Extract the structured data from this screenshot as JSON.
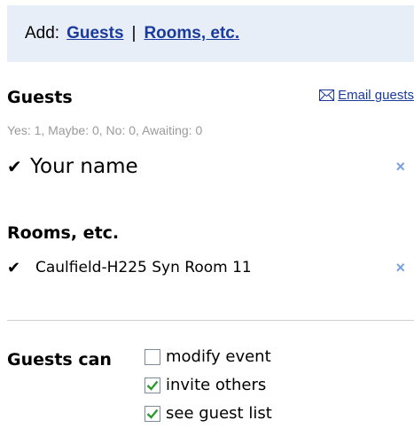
{
  "add_bar": {
    "label": "Add:",
    "guests_link": "Guests",
    "separator": "|",
    "rooms_link": "Rooms, etc."
  },
  "guests": {
    "title": "Guests",
    "email_link": "Email guests",
    "summary": "Yes: 1, Maybe: 0, No: 0, Awaiting: 0",
    "items": [
      {
        "check": "✔",
        "name": "Your name",
        "remove": "×"
      }
    ]
  },
  "rooms": {
    "title": "Rooms, etc.",
    "items": [
      {
        "check": "✔",
        "name": "Caulfield-H225 Syn Room 11",
        "remove": "×"
      }
    ]
  },
  "permissions": {
    "label": "Guests can",
    "options": [
      {
        "label": "modify event",
        "checked": false
      },
      {
        "label": "invite others",
        "checked": true
      },
      {
        "label": "see guest list",
        "checked": true
      }
    ]
  },
  "colors": {
    "link": "#1a3b9e",
    "remove": "#7aa0e0",
    "check_green": "#2e9a2e",
    "add_bar_bg": "#e8eef7"
  }
}
